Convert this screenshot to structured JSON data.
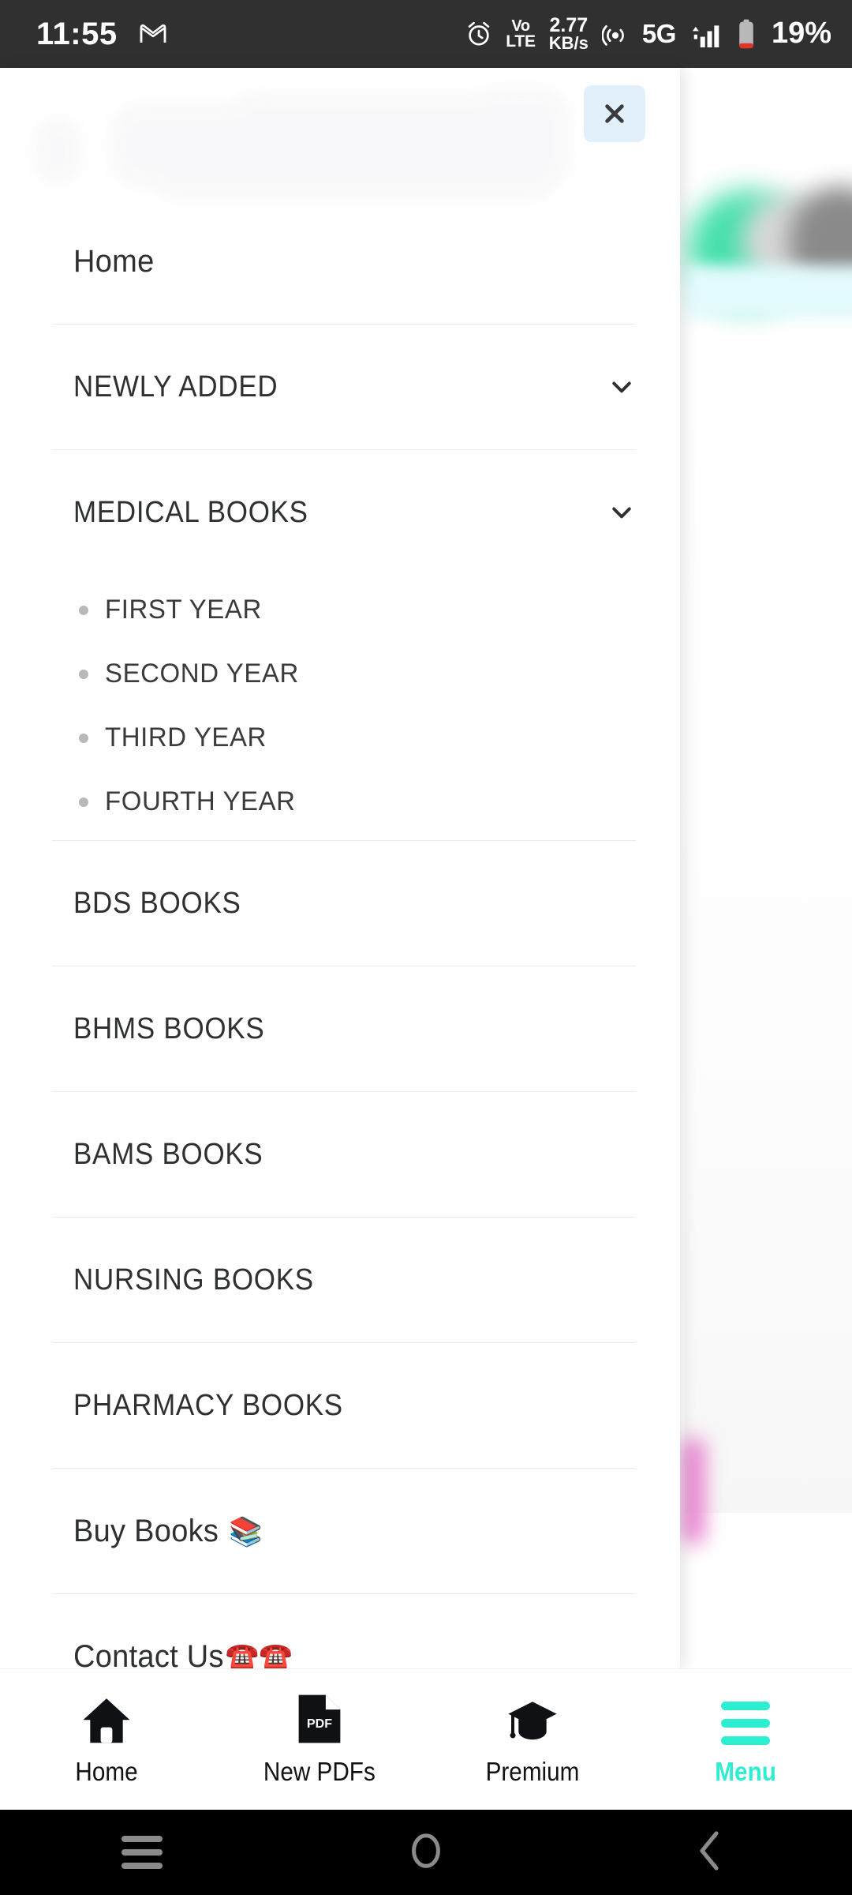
{
  "statusbar": {
    "time": "11:55",
    "gmail_icon": "gmail-icon",
    "alarm_icon": "alarm-clock-icon",
    "volte_top": "VoLTE",
    "volte_line1": "Vo",
    "volte_line2": "LTE",
    "netspeed_value": "2.77",
    "netspeed_unit": "KB/s",
    "cast_icon": "hotspot-icon",
    "network": "5G",
    "signal_icon": "signal-bars-icon",
    "battery_icon": "battery-icon",
    "battery": "19%"
  },
  "drawer": {
    "close_label": "✕",
    "items": [
      {
        "label": "Home",
        "style": "mixed",
        "expandable": false
      },
      {
        "label": "NEWLY ADDED",
        "style": "caps",
        "expandable": true
      },
      {
        "label": "MEDICAL BOOKS",
        "style": "caps",
        "expandable": true
      },
      {
        "label": "BDS BOOKS",
        "style": "caps",
        "expandable": false
      },
      {
        "label": "BHMS BOOKS",
        "style": "caps",
        "expandable": false
      },
      {
        "label": "BAMS BOOKS",
        "style": "caps",
        "expandable": false
      },
      {
        "label": "NURSING BOOKS",
        "style": "caps",
        "expandable": false
      },
      {
        "label": "PHARMACY BOOKS",
        "style": "caps",
        "expandable": false
      },
      {
        "label": "Buy Books ",
        "style": "mixed",
        "expandable": false,
        "emoji": "📚"
      },
      {
        "label": "Contact Us",
        "style": "mixed",
        "expandable": false,
        "emoji": "☎️☎️"
      }
    ],
    "medical_submenu": [
      {
        "label": "FIRST YEAR"
      },
      {
        "label": "SECOND YEAR"
      },
      {
        "label": "THIRD YEAR"
      },
      {
        "label": "FOURTH YEAR"
      }
    ]
  },
  "bottom_nav": {
    "items": [
      {
        "label": "Home",
        "icon": "home-icon",
        "active": false
      },
      {
        "label": "New PDFs",
        "icon": "pdf-file-icon",
        "active": false
      },
      {
        "label": "Premium",
        "icon": "graduation-cap-icon",
        "active": false
      },
      {
        "label": "Menu",
        "icon": "hamburger-menu-icon",
        "active": true
      }
    ]
  },
  "android_nav": {
    "recents": "recents-icon",
    "home": "home-circle-icon",
    "back": "back-chevron-icon"
  },
  "colors": {
    "accent": "#2eeed2",
    "close_bg": "#e2f0fb",
    "statusbar_bg": "#303030",
    "text": "#2f3032",
    "separator": "#ececec"
  }
}
